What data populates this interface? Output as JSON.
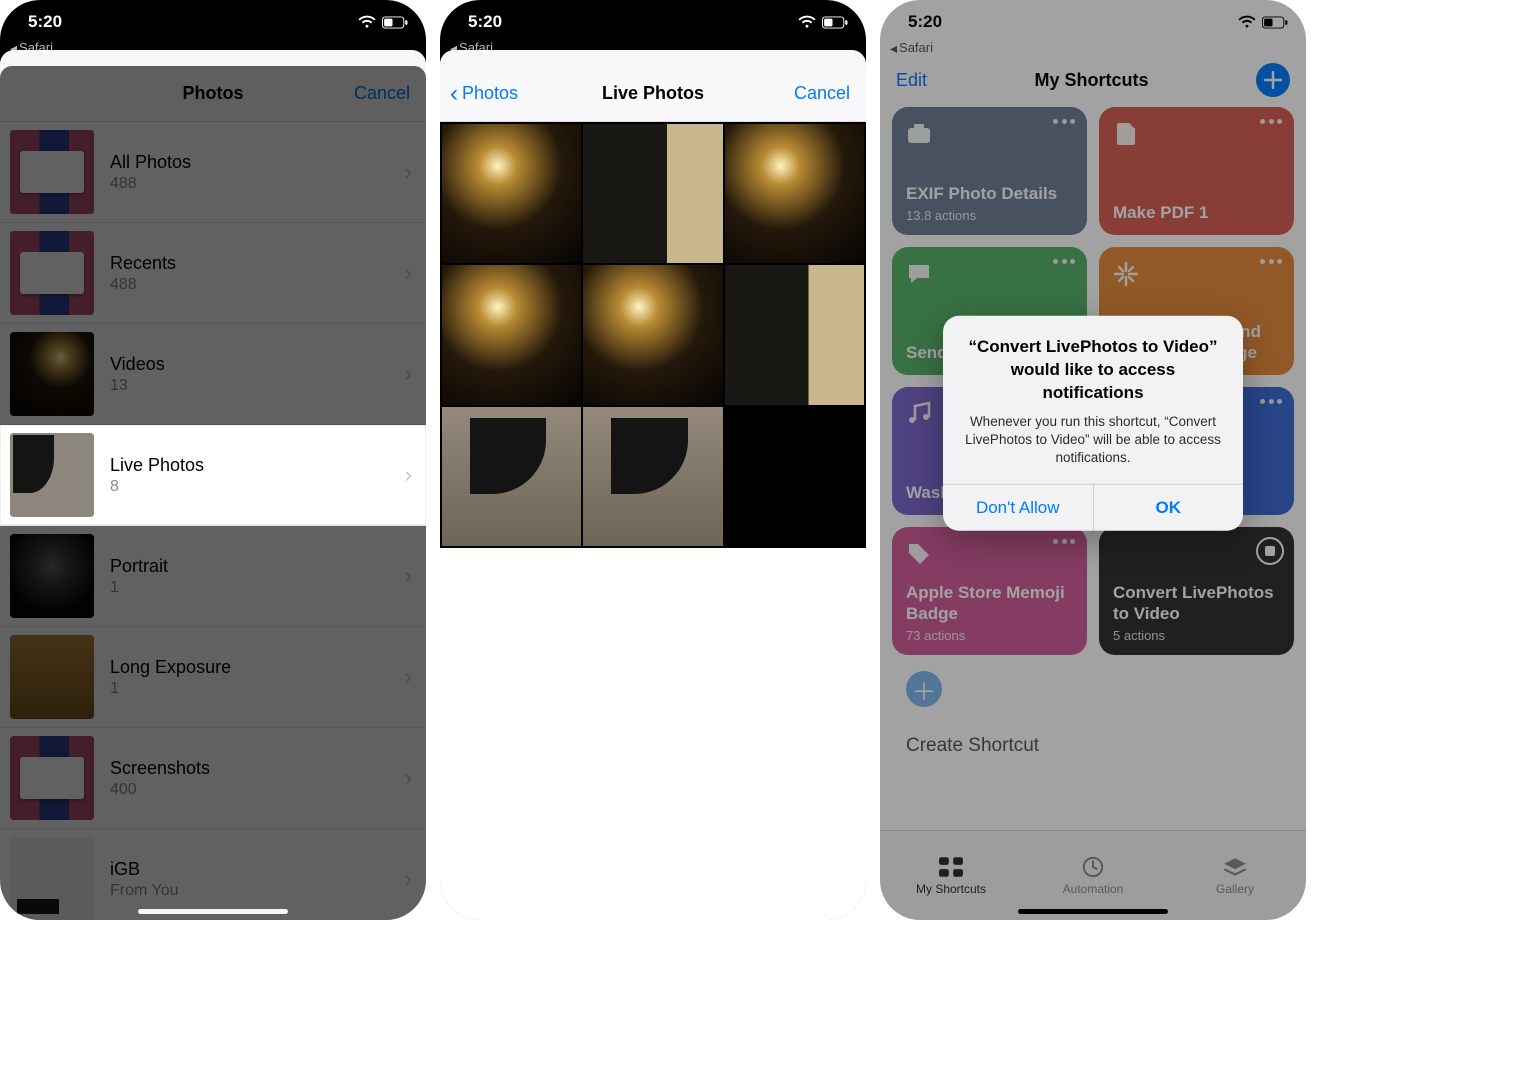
{
  "status": {
    "time": "5:20",
    "back_app": "Safari"
  },
  "panel1": {
    "header": {
      "title": "Photos",
      "cancel": "Cancel"
    },
    "albums": [
      {
        "name": "All Photos",
        "count": "488",
        "thumb": "collage"
      },
      {
        "name": "Recents",
        "count": "488",
        "thumb": "collage"
      },
      {
        "name": "Videos",
        "count": "13",
        "thumb": "dark"
      },
      {
        "name": "Live Photos",
        "count": "8",
        "thumb": "chair",
        "highlight": true
      },
      {
        "name": "Portrait",
        "count": "1",
        "thumb": "portrait"
      },
      {
        "name": "Long Exposure",
        "count": "1",
        "thumb": "warm"
      },
      {
        "name": "Screenshots",
        "count": "400",
        "thumb": "collage"
      },
      {
        "name": "iGB",
        "count": "From You",
        "thumb": "white"
      }
    ]
  },
  "panel2": {
    "header": {
      "back": "Photos",
      "title": "Live Photos",
      "cancel": "Cancel"
    },
    "photos": 8,
    "selected_index": 5
  },
  "panel3": {
    "nav": {
      "edit": "Edit",
      "title": "My Shortcuts"
    },
    "cards": [
      {
        "title": "EXIF Photo Details",
        "sub": "13.8 actions",
        "color": "slate",
        "icon": "camera"
      },
      {
        "title": "Make PDF 1",
        "sub": "",
        "color": "red",
        "icon": "document"
      },
      {
        "title": "Send delayed text",
        "sub": "",
        "color": "green",
        "icon": "chat"
      },
      {
        "title": "Record Audio And Send As Message",
        "sub": "",
        "color": "orange",
        "icon": "sparkle"
      },
      {
        "title": "Washing Hands",
        "sub": "",
        "color": "purple",
        "icon": "music"
      },
      {
        "title": "",
        "sub": "",
        "color": "blue",
        "icon": "none"
      },
      {
        "title": "Apple Store Memoji Badge",
        "sub": "73 actions",
        "color": "pink",
        "icon": "tag"
      },
      {
        "title": "Convert LivePhotos to Video",
        "sub": "5 actions",
        "color": "dark",
        "icon": "none",
        "running": true
      }
    ],
    "create": "Create Shortcut",
    "tabs": {
      "shortcuts": "My Shortcuts",
      "automation": "Automation",
      "gallery": "Gallery"
    },
    "alert": {
      "title": "“Convert LivePhotos to Video” would like to access notifications",
      "message": "Whenever you run this shortcut, “Convert LivePhotos to Video” will be able to access notifications.",
      "deny": "Don't Allow",
      "ok": "OK"
    }
  }
}
